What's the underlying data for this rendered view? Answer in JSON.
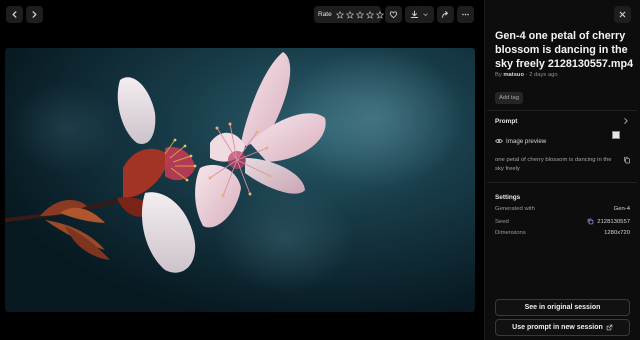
{
  "toolbar": {
    "rate_label": "Rate",
    "stars_total": 5,
    "stars_selected": 0
  },
  "asset": {
    "title": "Gen-4 one petal of cherry blossom is dancing in the sky freely 2128130557.mp4",
    "by_prefix": "By",
    "author": "matsuo",
    "time_ago": "2 days ago",
    "add_tag_label": "Add tag"
  },
  "prompt": {
    "heading": "Prompt",
    "image_preview_label": "Image preview",
    "text": "one petal of cherry blossom is dancing in the sky freely"
  },
  "settings": {
    "heading": "Settings",
    "rows": [
      {
        "label": "Generated with",
        "value": "Gen-4"
      },
      {
        "label": "Seed",
        "value": "2128130557"
      },
      {
        "label": "Dimensions",
        "value": "1280x720"
      }
    ]
  },
  "actions": {
    "see_original": "See in original session",
    "use_prompt": "Use prompt in new session"
  },
  "icons": {
    "back": "chevron-left-icon",
    "forward": "chevron-right-icon",
    "favorite": "heart-icon",
    "download": "download-icon",
    "share": "share-icon",
    "more": "more-icon",
    "close": "close-icon",
    "accent": "#8fa3ff"
  }
}
